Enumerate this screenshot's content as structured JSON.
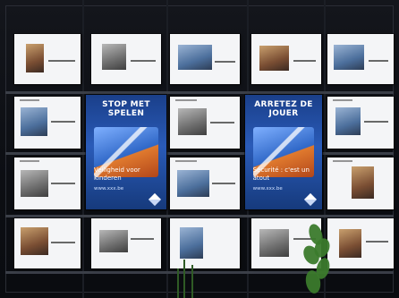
{
  "scene": {
    "type": "photo-of-display-wall",
    "background_color": "#0b0d12"
  },
  "posters": [
    {
      "headline": "STOP MET SPELEN",
      "subline": "Veiligheid voor kinderen",
      "small": "www.xxx.be"
    },
    {
      "headline": "ARRETEZ DE JOUER",
      "subline": "Sécurité : c'est un atout",
      "small": "www.xxx.be"
    }
  ]
}
